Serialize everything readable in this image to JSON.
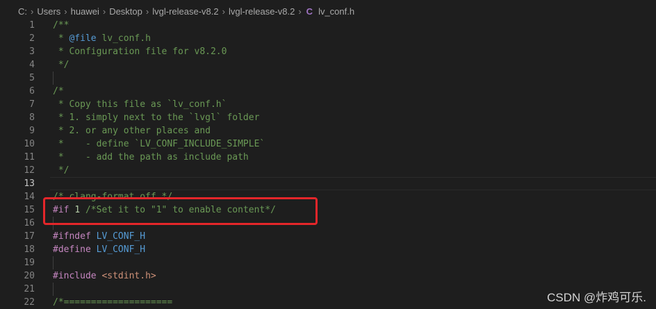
{
  "breadcrumb": {
    "items": [
      "C:",
      "Users",
      "huawei",
      "Desktop",
      "lvgl-release-v8.2",
      "lvgl-release-v8.2"
    ],
    "separator": "›",
    "file_icon": "C",
    "file_name": "lv_conf.h"
  },
  "editor": {
    "active_line": "13",
    "lines": [
      {
        "n": "1",
        "segments": [
          {
            "t": "/**",
            "c": "comment"
          }
        ]
      },
      {
        "n": "2",
        "segments": [
          {
            "t": " * ",
            "c": "comment"
          },
          {
            "t": "@file",
            "c": "mac"
          },
          {
            "t": " lv_conf.h",
            "c": "comment"
          }
        ]
      },
      {
        "n": "3",
        "segments": [
          {
            "t": " * Configuration file for v8.2.0",
            "c": "comment"
          }
        ]
      },
      {
        "n": "4",
        "segments": [
          {
            "t": " */",
            "c": "comment"
          }
        ]
      },
      {
        "n": "5",
        "segments": []
      },
      {
        "n": "6",
        "segments": [
          {
            "t": "/*",
            "c": "comment"
          }
        ]
      },
      {
        "n": "7",
        "segments": [
          {
            "t": " * Copy this file as `lv_conf.h`",
            "c": "comment"
          }
        ]
      },
      {
        "n": "8",
        "segments": [
          {
            "t": " * 1. simply next to the `lvgl` folder",
            "c": "comment"
          }
        ]
      },
      {
        "n": "9",
        "segments": [
          {
            "t": " * 2. or any other places and",
            "c": "comment"
          }
        ]
      },
      {
        "n": "10",
        "segments": [
          {
            "t": " *    - define `LV_CONF_INCLUDE_SIMPLE`",
            "c": "comment"
          }
        ]
      },
      {
        "n": "11",
        "segments": [
          {
            "t": " *    - add the path as include path",
            "c": "comment"
          }
        ]
      },
      {
        "n": "12",
        "segments": [
          {
            "t": " */",
            "c": "comment"
          }
        ]
      },
      {
        "n": "13",
        "segments": []
      },
      {
        "n": "14",
        "segments": [
          {
            "t": "/* clang-format off */",
            "c": "comment"
          }
        ]
      },
      {
        "n": "15",
        "segments": [
          {
            "t": "#if",
            "c": "kw"
          },
          {
            "t": " ",
            "c": ""
          },
          {
            "t": "1",
            "c": "num"
          },
          {
            "t": " /*Set it to \"1\" to enable content*/",
            "c": "comment"
          }
        ]
      },
      {
        "n": "16",
        "segments": []
      },
      {
        "n": "17",
        "segments": [
          {
            "t": "#ifndef",
            "c": "kw"
          },
          {
            "t": " LV_CONF_H",
            "c": "mac"
          }
        ]
      },
      {
        "n": "18",
        "segments": [
          {
            "t": "#define",
            "c": "kw"
          },
          {
            "t": " LV_CONF_H",
            "c": "mac"
          }
        ]
      },
      {
        "n": "19",
        "segments": []
      },
      {
        "n": "20",
        "segments": [
          {
            "t": "#include",
            "c": "kw"
          },
          {
            "t": " <stdint.h>",
            "c": "str"
          }
        ]
      },
      {
        "n": "21",
        "segments": []
      },
      {
        "n": "22",
        "segments": [
          {
            "t": "/*====================",
            "c": "comment"
          }
        ]
      }
    ]
  },
  "watermark": "CSDN @炸鸡可乐.",
  "colors": {
    "background": "#1e1e1e",
    "comment": "#6a9955",
    "keyword": "#c586c0",
    "number": "#b5cea8",
    "macro": "#569cd6",
    "string": "#ce9178",
    "highlight_box": "#e4262a"
  }
}
